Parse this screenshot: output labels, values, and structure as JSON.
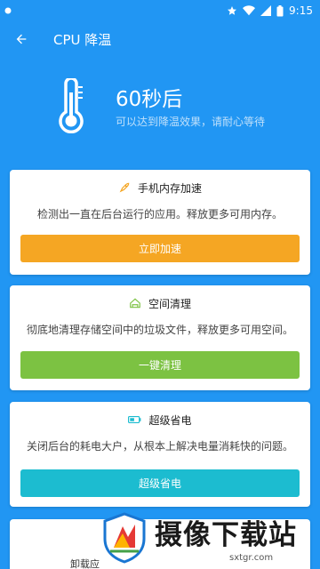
{
  "status": {
    "time": "9:15"
  },
  "header": {
    "title": "CPU 降温"
  },
  "hero": {
    "time_text": "60秒后",
    "subtitle": "可以达到降温效果，请耐心等待"
  },
  "cards": [
    {
      "title": "手机内存加速",
      "description": "检测出一直在后台运行的应用。释放更多可用内存。",
      "button": "立即加速",
      "button_color": "#F5A623",
      "icon": "rocket-icon"
    },
    {
      "title": "空间清理",
      "description": "彻底地清理存储空间中的垃圾文件，释放更多可用空间。",
      "button": "一键清理",
      "button_color": "#7CC242",
      "icon": "broom-icon"
    },
    {
      "title": "超级省电",
      "description": "关闭后台的耗电大户，从根本上解决电量消耗快的问题。",
      "button": "超级省电",
      "button_color": "#1CBCD0",
      "icon": "battery-icon"
    },
    {
      "title": "卸载应"
    }
  ],
  "watermark": {
    "brand": "摄像下载站",
    "url": "sxtgr.com"
  }
}
